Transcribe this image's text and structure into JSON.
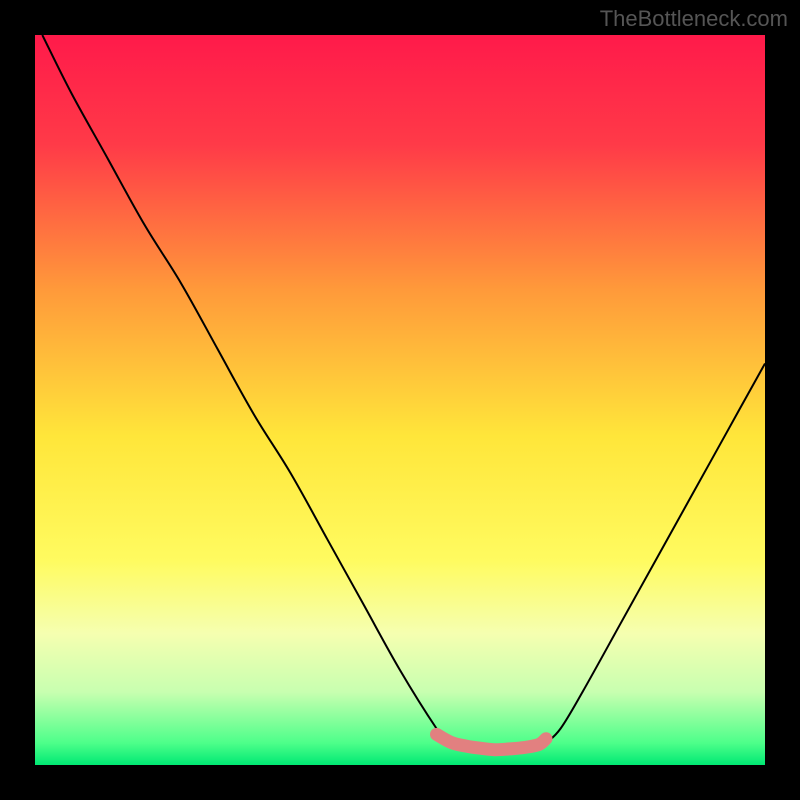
{
  "watermark": "TheBottleneck.com",
  "chart_data": {
    "type": "line",
    "title": "",
    "xlabel": "",
    "ylabel": "",
    "xlim": [
      0,
      100
    ],
    "ylim": [
      0,
      100
    ],
    "background_gradient": {
      "stops": [
        {
          "pos": 0,
          "color": "#ff1a4a"
        },
        {
          "pos": 15,
          "color": "#ff3a48"
        },
        {
          "pos": 35,
          "color": "#ff9a3a"
        },
        {
          "pos": 55,
          "color": "#ffe63a"
        },
        {
          "pos": 72,
          "color": "#fffb60"
        },
        {
          "pos": 82,
          "color": "#f5ffb0"
        },
        {
          "pos": 90,
          "color": "#c8ffb0"
        },
        {
          "pos": 97,
          "color": "#4dff8a"
        },
        {
          "pos": 100,
          "color": "#00e873"
        }
      ]
    },
    "series": [
      {
        "name": "bottleneck-curve",
        "color": "#000000",
        "x": [
          1,
          5,
          10,
          15,
          20,
          25,
          30,
          35,
          40,
          45,
          50,
          55,
          56,
          58,
          60,
          63,
          66,
          69,
          70,
          72,
          75,
          80,
          85,
          90,
          95,
          100
        ],
        "y": [
          100,
          92,
          83,
          74,
          66,
          57,
          48,
          40,
          31,
          22,
          13,
          5,
          4,
          3,
          2.4,
          2,
          2,
          2.2,
          3,
          5,
          10,
          19,
          28,
          37,
          46,
          55
        ]
      },
      {
        "name": "optimal-range-marker",
        "color": "#e57373",
        "x": [
          55,
          57,
          59,
          61,
          63,
          65,
          67,
          69,
          70
        ],
        "y": [
          4.2,
          3.1,
          2.6,
          2.3,
          2.1,
          2.2,
          2.4,
          2.8,
          3.6
        ]
      }
    ]
  }
}
